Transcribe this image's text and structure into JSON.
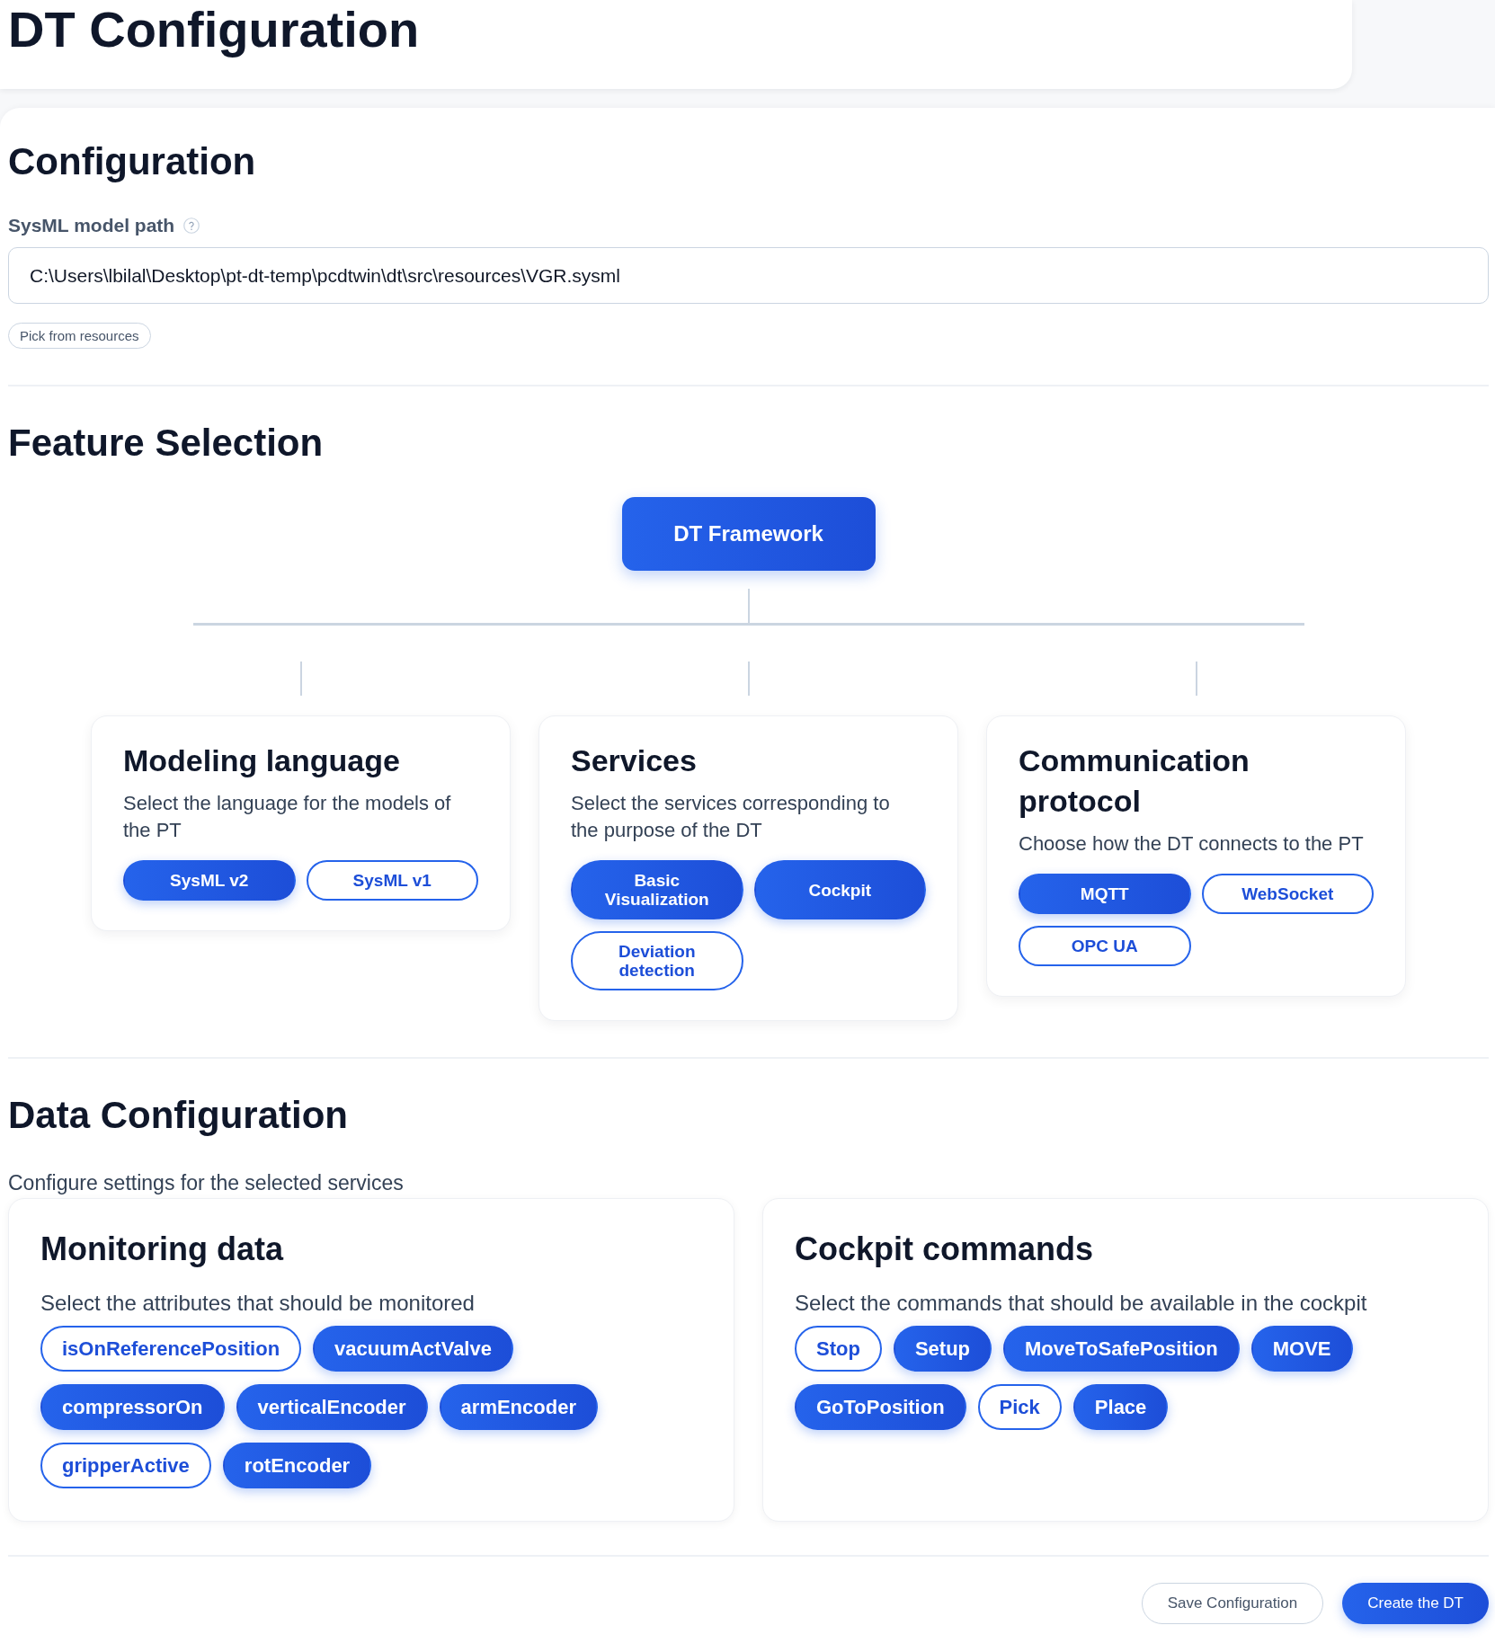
{
  "page": {
    "title": "DT Configuration"
  },
  "configuration": {
    "heading": "Configuration",
    "model_path": {
      "label": "SysML model path",
      "value": "C:\\Users\\lbilal\\Desktop\\pt-dt-temp\\pcdtwin\\dt\\src\\resources\\VGR.sysml"
    },
    "pick_button": "Pick from resources"
  },
  "feature_selection": {
    "heading": "Feature Selection",
    "root": "DT Framework",
    "groups": [
      {
        "title": "Modeling language",
        "description": "Select the language for the models of the PT",
        "options": [
          {
            "label": "SysML v2",
            "selected": true
          },
          {
            "label": "SysML v1",
            "selected": false
          }
        ]
      },
      {
        "title": "Services",
        "description": "Select the services corresponding to the purpose of the DT",
        "options": [
          {
            "label": "Basic Visualization",
            "selected": true
          },
          {
            "label": "Cockpit",
            "selected": true
          },
          {
            "label": "Deviation detection",
            "selected": false
          }
        ]
      },
      {
        "title": "Communication protocol",
        "description": "Choose how the DT connects to the PT",
        "options": [
          {
            "label": "MQTT",
            "selected": true
          },
          {
            "label": "WebSocket",
            "selected": false
          },
          {
            "label": "OPC UA",
            "selected": false
          }
        ]
      }
    ]
  },
  "data_configuration": {
    "heading": "Data Configuration",
    "description": "Configure settings for the selected services",
    "panels": [
      {
        "title": "Monitoring data",
        "description": "Select the attributes that should be monitored",
        "options": [
          {
            "label": "isOnReferencePosition",
            "selected": false
          },
          {
            "label": "vacuumActValve",
            "selected": true
          },
          {
            "label": "compressorOn",
            "selected": true
          },
          {
            "label": "verticalEncoder",
            "selected": true
          },
          {
            "label": "armEncoder",
            "selected": true
          },
          {
            "label": "gripperActive",
            "selected": false
          },
          {
            "label": "rotEncoder",
            "selected": true
          }
        ]
      },
      {
        "title": "Cockpit commands",
        "description": "Select the commands that should be available in the cockpit",
        "options": [
          {
            "label": "Stop",
            "selected": false
          },
          {
            "label": "Setup",
            "selected": true
          },
          {
            "label": "MoveToSafePosition",
            "selected": true
          },
          {
            "label": "MOVE",
            "selected": true
          },
          {
            "label": "GoToPosition",
            "selected": true
          },
          {
            "label": "Pick",
            "selected": false
          },
          {
            "label": "Place",
            "selected": true
          }
        ]
      }
    ]
  },
  "actions": [
    {
      "label": "Save Configuration",
      "kind": "secondary"
    },
    {
      "label": "Create the DT",
      "kind": "primary"
    }
  ]
}
